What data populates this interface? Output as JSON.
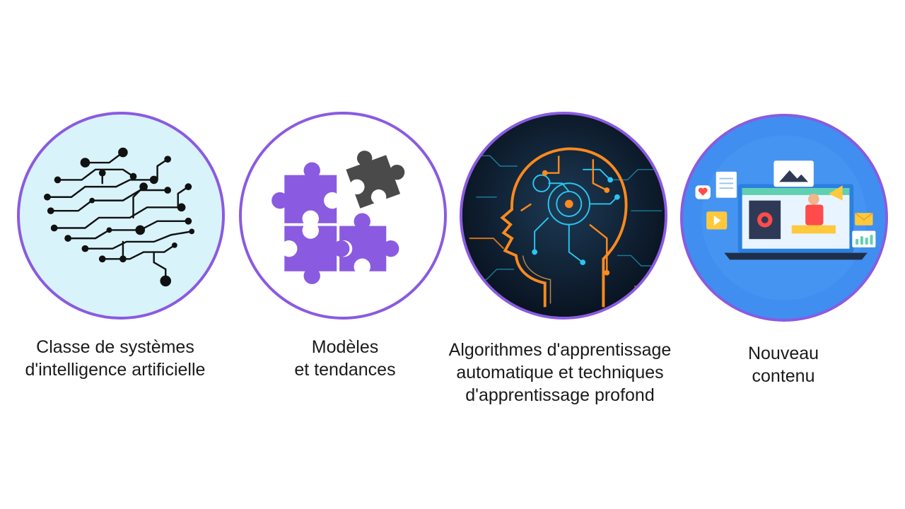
{
  "cards": [
    {
      "icon": "brain-circuit-icon",
      "caption_line1": "Classe de systèmes",
      "caption_line2": "d'intelligence artificielle"
    },
    {
      "icon": "puzzle-pieces-icon",
      "caption_line1": "Modèles",
      "caption_line2": "et tendances"
    },
    {
      "icon": "ai-head-circuit-icon",
      "caption_line1": "Algorithmes d'apprentissage",
      "caption_line2": "automatique et techniques",
      "caption_line3": "d'apprentissage profond"
    },
    {
      "icon": "laptop-content-icon",
      "caption_line1": "Nouveau",
      "caption_line2": "contenu"
    }
  ],
  "colors": {
    "circle_border": "#8a5be0",
    "puzzle_purple": "#8a5be0",
    "puzzle_gray": "#4a4a4a",
    "brain_bg": "#d9f3fb",
    "content_bg": "#3f8ef0",
    "circuit_orange": "#ff8a1e",
    "circuit_cyan": "#29c6f0"
  }
}
